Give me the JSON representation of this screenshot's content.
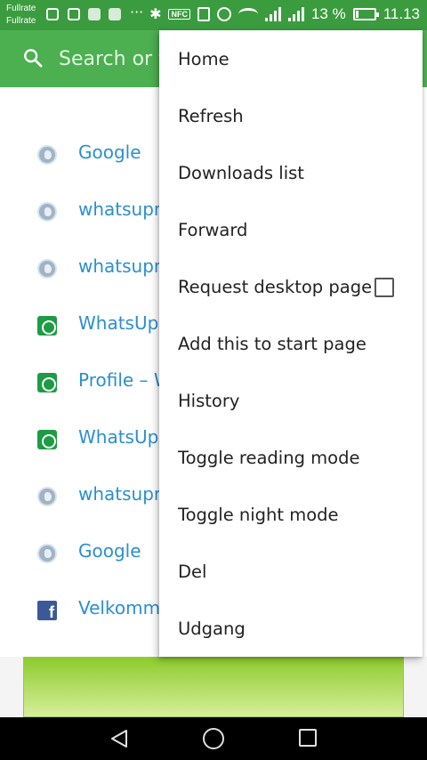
{
  "status_bar": {
    "carrier_line1": "Fullrate",
    "carrier_line2": "Fullrate",
    "overflow": "···",
    "nfc": "NFC",
    "battery_text": "13 %",
    "time": "11.13"
  },
  "toolbar": {
    "search_placeholder": "Search or type URL"
  },
  "history": [
    {
      "label": "Google",
      "icon": "globe-icon"
    },
    {
      "label": "whatsupnewsmagazine",
      "icon": "globe-icon"
    },
    {
      "label": "whatsupnewsmagazine",
      "icon": "globe-icon"
    },
    {
      "label": "WhatsUp",
      "icon": "whatsapp-icon"
    },
    {
      "label": "Profile – WhatsUp",
      "icon": "whatsapp-icon"
    },
    {
      "label": "WhatsUp",
      "icon": "whatsapp-icon"
    },
    {
      "label": "whatsupnewsmagazine",
      "icon": "globe-icon"
    },
    {
      "label": "Google",
      "icon": "globe-icon"
    },
    {
      "label": "Velkommen til Facebook",
      "icon": "facebook-icon"
    }
  ],
  "menu": {
    "items": [
      {
        "label": "Home"
      },
      {
        "label": "Refresh"
      },
      {
        "label": "Downloads list"
      },
      {
        "label": "Forward"
      },
      {
        "label": "Request desktop page"
      },
      {
        "label": "Add this to start page"
      },
      {
        "label": "History"
      },
      {
        "label": "Toggle reading mode"
      },
      {
        "label": "Toggle night mode"
      },
      {
        "label": "Del"
      },
      {
        "label": "Udgang"
      }
    ],
    "request_desktop_checked": false
  },
  "colors": {
    "status_bar": "#3a9c3e",
    "toolbar": "#4caf50",
    "link": "#2b8fd0"
  }
}
